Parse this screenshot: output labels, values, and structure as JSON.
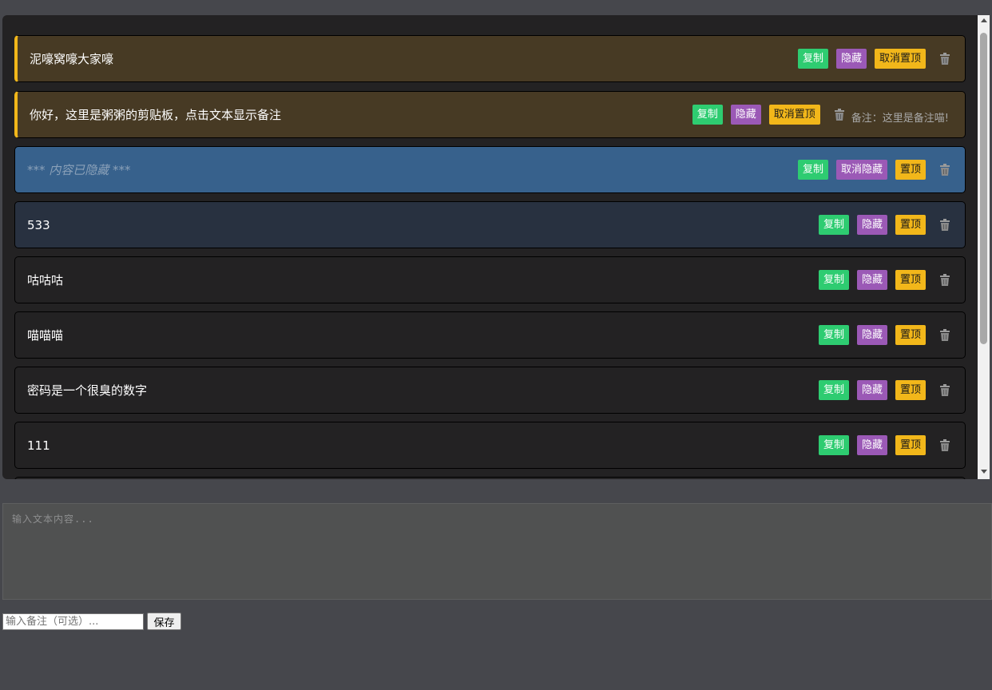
{
  "clipboard": {
    "items": [
      {
        "text": "泥嚎窝嚎大家嚎",
        "copy_label": "复制",
        "hide_label": "隐藏",
        "pin_label": "取消置顶",
        "note": ""
      },
      {
        "text": "你好，这里是粥粥的剪贴板，点击文本显示备注",
        "copy_label": "复制",
        "hide_label": "隐藏",
        "pin_label": "取消置顶",
        "note": "备注：这里是备注喵!"
      },
      {
        "text": "*** 内容已隐藏 ***",
        "copy_label": "复制",
        "hide_label": "取消隐藏",
        "pin_label": "置顶",
        "note": ""
      },
      {
        "text": "533",
        "copy_label": "复制",
        "hide_label": "隐藏",
        "pin_label": "置顶",
        "note": ""
      },
      {
        "text": "咕咕咕",
        "copy_label": "复制",
        "hide_label": "隐藏",
        "pin_label": "置顶",
        "note": ""
      },
      {
        "text": "喵喵喵",
        "copy_label": "复制",
        "hide_label": "隐藏",
        "pin_label": "置顶",
        "note": ""
      },
      {
        "text": "密码是一个很臭的数字",
        "copy_label": "复制",
        "hide_label": "隐藏",
        "pin_label": "置顶",
        "note": ""
      },
      {
        "text": "111",
        "copy_label": "复制",
        "hide_label": "隐藏",
        "pin_label": "置顶",
        "note": ""
      }
    ]
  },
  "editor": {
    "text_placeholder": "输入文本内容...",
    "note_placeholder": "输入备注（可选）...",
    "save_label": "保存"
  },
  "colors": {
    "copy": "#2ecc71",
    "hide": "#9b59b6",
    "pin": "#f2b71a",
    "pinned_bg": "#473a24",
    "hidden_bg": "#37618c",
    "background": "#46474c"
  },
  "icons": {
    "delete": "trash-icon"
  }
}
